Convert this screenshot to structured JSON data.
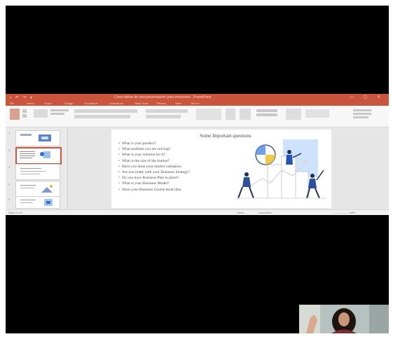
{
  "app": {
    "quick_access": "▪ ↶ ↷ ▾",
    "document_title": "Crear tablas de una presentación para entrevista - PowerPoint",
    "window_controls": "— ▢ ✕",
    "tabs": [
      "File",
      "Home",
      "Insert",
      "Design",
      "Transitions",
      "Animations",
      "Slide Show",
      "Review",
      "View",
      "Tell me"
    ]
  },
  "thumbnails": [
    {
      "number": "1"
    },
    {
      "number": "2",
      "selected": true
    },
    {
      "number": "3"
    },
    {
      "number": "4"
    },
    {
      "number": "5"
    }
  ],
  "slide": {
    "title": "Some Important questions",
    "bullets": [
      "What is your product?",
      "What problem you are solving?",
      "What is your solution for it?",
      "What is the size of the market?",
      "Have you done your market validation",
      "Are you ready with your Business Strategy?",
      "Do you have Business Plan in place?",
      "What is your Business Model?",
      "Short your Business Course book idea."
    ]
  },
  "status_bar": {
    "left": "Slide 2 of 5",
    "notes": "Notes",
    "comments": "Comments",
    "zoom": "— ——— + 65%"
  },
  "colors": {
    "background": "#000000",
    "ribbon_accent": "#c9553c",
    "bullet_accent": "#1f5fd1"
  }
}
